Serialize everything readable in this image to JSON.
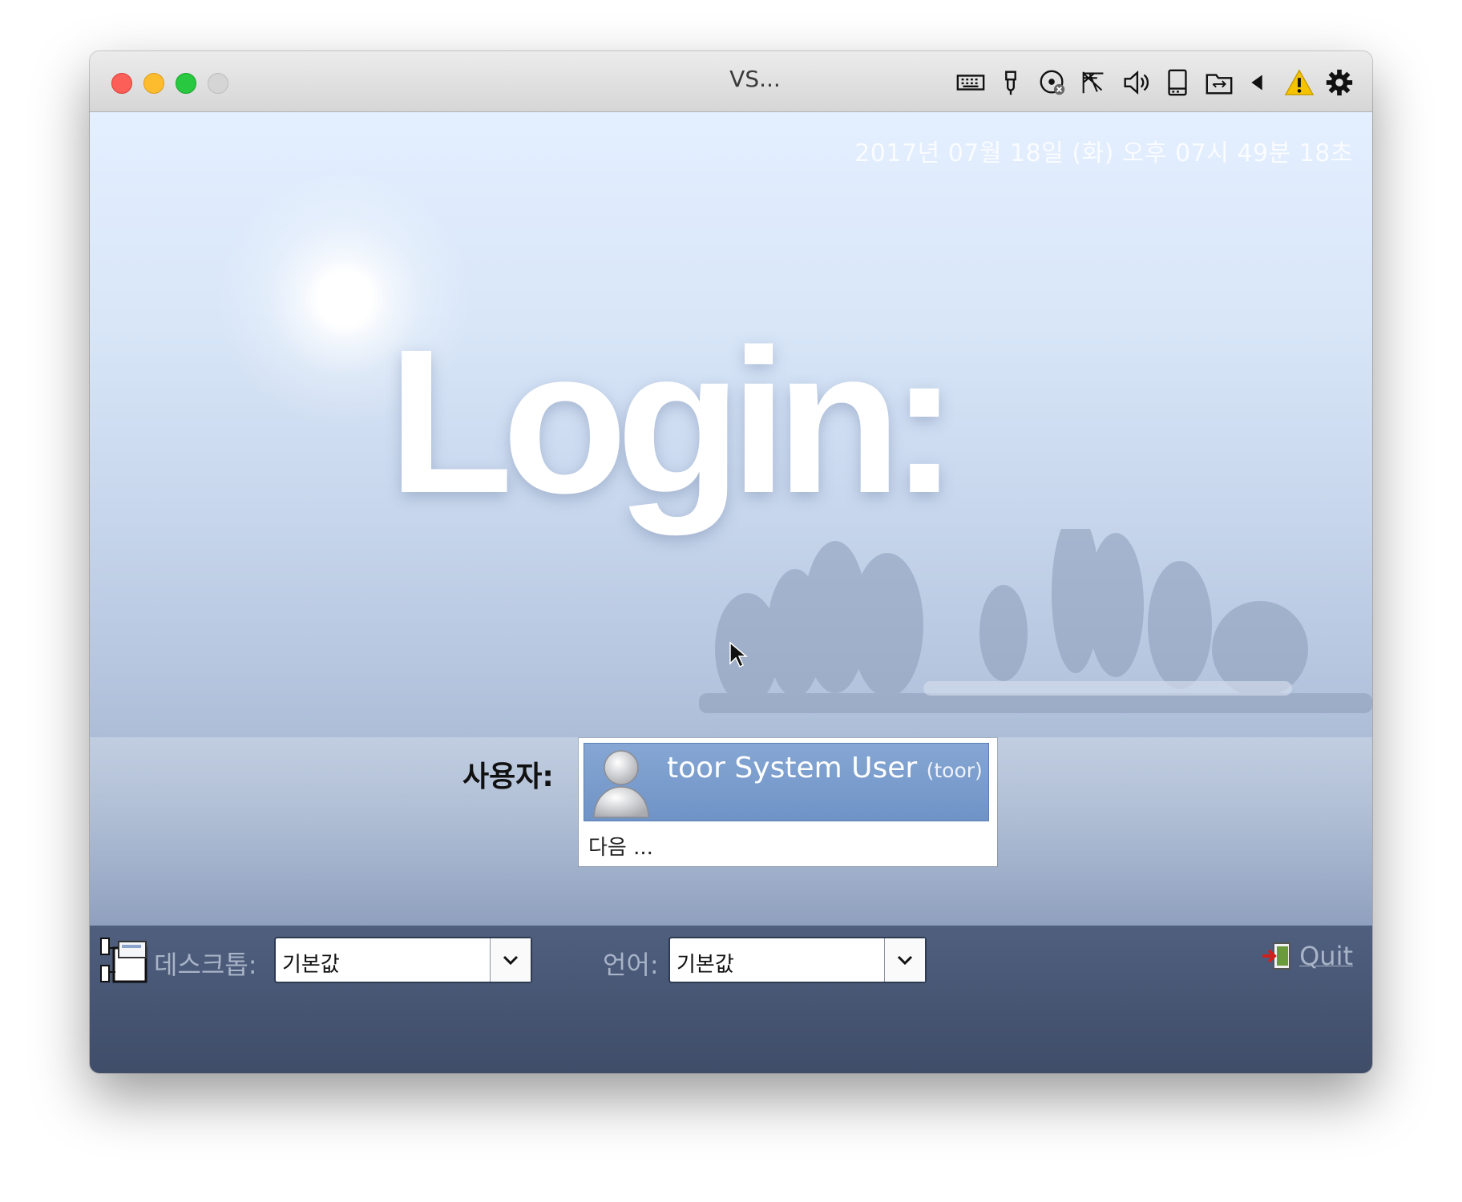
{
  "window": {
    "title": "VS...",
    "controls": [
      "close",
      "minimize",
      "zoom",
      "fullscreen-disabled"
    ],
    "toolbar_icons": [
      "keyboard-icon",
      "usb-icon",
      "optical-disc-icon",
      "network-icon",
      "audio-icon",
      "storage-icon",
      "shared-folder-icon",
      "arrow-left-icon",
      "warning-icon",
      "settings-icon"
    ]
  },
  "screen": {
    "clock": "2017년 07월 18일 (화) 오후 07시 49분 18초",
    "login_title": "Login:",
    "user_section": {
      "label": "사용자:",
      "users": [
        {
          "display_name": "toor System User",
          "login": "(toor)",
          "selected": true
        }
      ],
      "other_option": "다음 ..."
    },
    "bottom_bar": {
      "desktop_label": "데스크톱:",
      "desktop_value": "기본값",
      "language_label": "언어:",
      "language_value": "기본값",
      "quit_label": "Quit"
    }
  },
  "colors": {
    "selection": "#7399cb",
    "bar": "#485776",
    "close": "#fc5f57",
    "minimize": "#fdbc2e",
    "zoom": "#28c840",
    "warning": "#f5c400"
  }
}
